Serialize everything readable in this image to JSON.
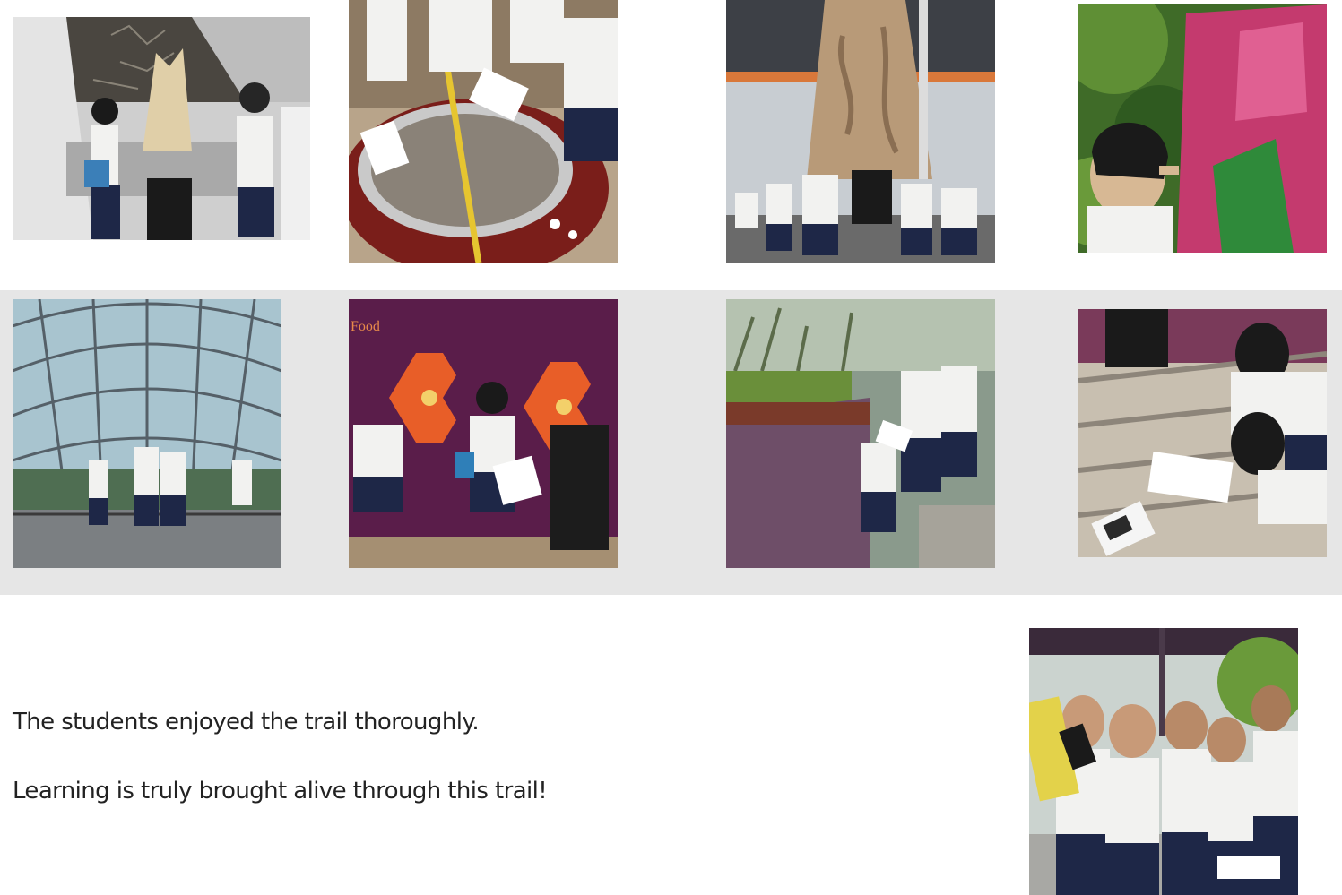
{
  "gallery": {
    "photos": [
      {
        "name": "photo-exhibit-sculpture",
        "scene": "students-at-exhibit"
      },
      {
        "name": "photo-measuring-display",
        "scene": "students-measuring"
      },
      {
        "name": "photo-tree-trunk",
        "scene": "students-at-tree"
      },
      {
        "name": "photo-jungle-signboard",
        "scene": "student-reading-sign"
      },
      {
        "name": "photo-cloud-dome-walkway",
        "scene": "students-on-walkway"
      },
      {
        "name": "photo-food-wall",
        "scene": "students-at-food-wall"
      },
      {
        "name": "photo-planter-worksheet",
        "scene": "students-writing"
      },
      {
        "name": "photo-steps-clipboards",
        "scene": "students-on-steps"
      },
      {
        "name": "photo-group-posing",
        "scene": "students-posing"
      }
    ],
    "wall_label": "Food"
  },
  "caption": {
    "line1": "The students enjoyed the trail thoroughly.",
    "line2": "Learning is truly brought alive through this trail!"
  },
  "colors": {
    "background": "#ffffff",
    "band_gray": "#e6e6e6",
    "text": "#222222",
    "uniform_white": "#f2f2f0",
    "uniform_navy": "#1e2747",
    "accent_green": "#8fc43c",
    "wall_purple": "#5a1d4a",
    "display_red": "#7a1e1a"
  }
}
